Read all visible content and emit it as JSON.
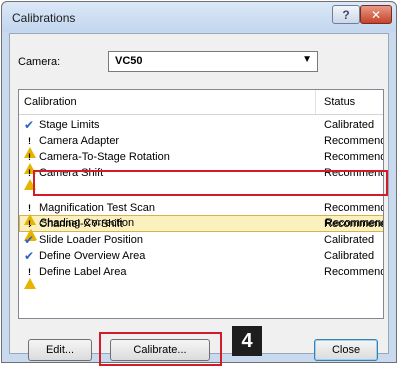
{
  "window": {
    "title": "Calibrations",
    "help_glyph": "?",
    "close_glyph": "✕"
  },
  "camera": {
    "label": "Camera:",
    "value": "VC50"
  },
  "list": {
    "col_calibration": "Calibration",
    "col_status": "Status",
    "rows": [
      {
        "name": "Stage Limits",
        "status": "Calibrated",
        "icon": "check"
      },
      {
        "name": "Camera Adapter",
        "status": "Recommended",
        "icon": "warning"
      },
      {
        "name": "Camera-To-Stage Rotation",
        "status": "Recommended",
        "icon": "warning"
      },
      {
        "name": "Camera Shift",
        "status": "Recommended",
        "icon": "warning"
      },
      {
        "name": "Shading Correction",
        "status": "Recommended",
        "icon": "warning",
        "selected": true
      },
      {
        "name": "Magnification Test Scan",
        "status": "Recommended",
        "icon": "warning"
      },
      {
        "name": "Channel-XY-Shift",
        "status": "Recommended",
        "icon": "warning"
      },
      {
        "name": "Slide Loader Position",
        "status": "Calibrated",
        "icon": "check"
      },
      {
        "name": "Define Overview Area",
        "status": "Calibrated",
        "icon": "check"
      },
      {
        "name": "Define Label Area",
        "status": "Recommended",
        "icon": "warning"
      }
    ]
  },
  "buttons": {
    "edit": "Edit...",
    "calibrate": "Calibrate...",
    "close": "Close"
  },
  "annotation": {
    "step": "4"
  },
  "colors": {
    "highlight": "#d11d2a",
    "check": "#2a62c6",
    "warning": "#e6b400"
  }
}
